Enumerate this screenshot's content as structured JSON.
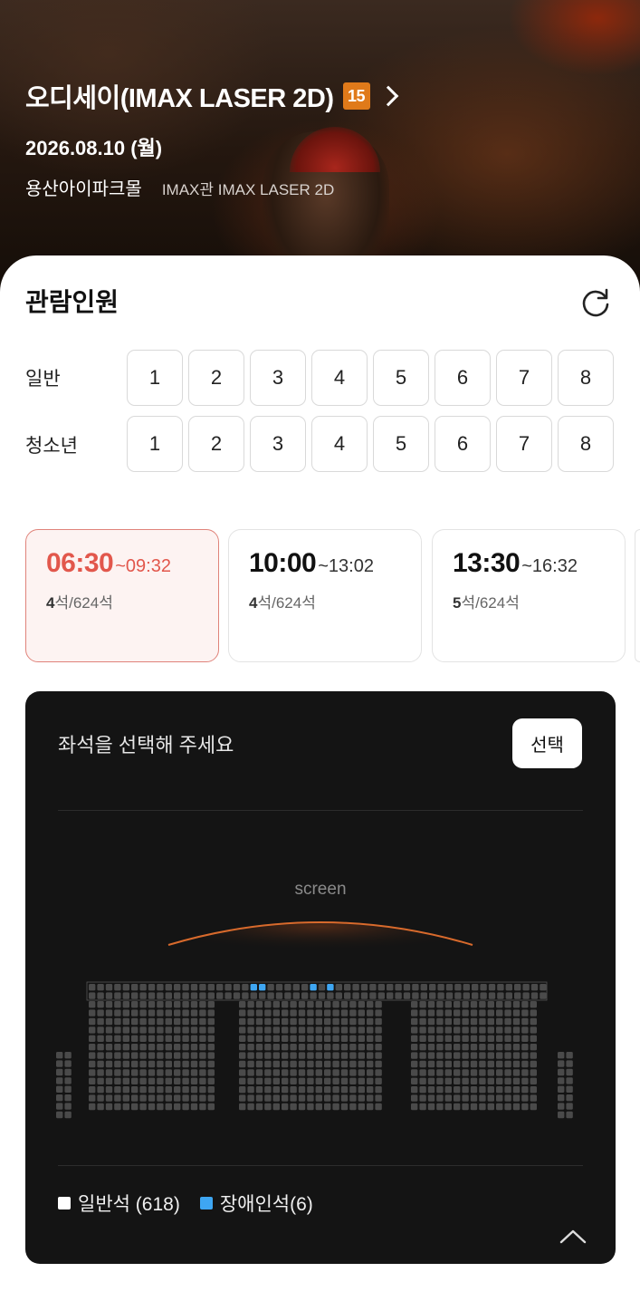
{
  "movie": {
    "title": "오디세이(IMAX LASER 2D)",
    "age_rating": "15",
    "date": "2026.08.10 (월)",
    "theater": "용산아이파크몰",
    "screen": "IMAX관 IMAX LASER 2D"
  },
  "headcount": {
    "title": "관람인원",
    "rows": [
      {
        "label": "일반",
        "options": [
          "1",
          "2",
          "3",
          "4",
          "5",
          "6",
          "7",
          "8"
        ]
      },
      {
        "label": "청소년",
        "options": [
          "1",
          "2",
          "3",
          "4",
          "5",
          "6",
          "7",
          "8"
        ]
      }
    ]
  },
  "showtimes": [
    {
      "start": "06:30",
      "end": "~09:32",
      "remaining": "4",
      "total": "석/624석",
      "selected": true
    },
    {
      "start": "10:00",
      "end": "~13:02",
      "remaining": "4",
      "total": "석/624석",
      "selected": false
    },
    {
      "start": "13:30",
      "end": "~16:32",
      "remaining": "5",
      "total": "석/624석",
      "selected": false
    }
  ],
  "seat_panel": {
    "prompt": "좌석을 선택해 주세요",
    "select_label": "선택",
    "screen_label": "screen",
    "legend": [
      {
        "label": "일반석 (618)",
        "color": "#ffffff"
      },
      {
        "label": "장애인석(6)",
        "color": "#3ea6f2"
      }
    ]
  },
  "colors": {
    "accent": "#e2574c",
    "seat": "#4a4a4a",
    "accessible_seat": "#3ea6f2"
  }
}
